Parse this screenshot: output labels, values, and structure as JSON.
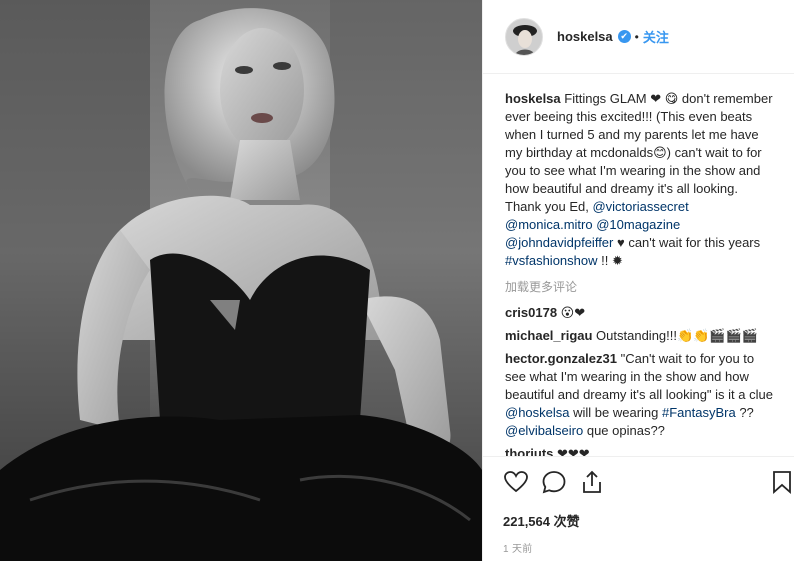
{
  "post": {
    "username": "hoskelsa",
    "verified_glyph": "✔",
    "separator": "•",
    "follow_label": "关注",
    "caption": {
      "user": "hoskelsa",
      "text": " Fittings GLAM ❤ 😋 don't remember ever beeing this excited!!! (This even beats when I turned 5 and my parents let me have my birthday at mcdonalds😊) can't wait to for you to see what I'm wearing in the show and how beautiful and dreamy it's all looking. Thank you Ed, ",
      "mention1": "@victoriassecret",
      "mention2": "@monica.mitro",
      "mention3": "@10magazine",
      "mention4": "@johndavidpfeiffer",
      "text2": " ♥ can't wait for this years ",
      "hashtag": "#vsfashionshow",
      "text3": " !! ✹"
    },
    "load_more": "加载更多评论",
    "comments": [
      {
        "user": "cris0178",
        "text": " 😮❤"
      },
      {
        "user": "michael_rigau",
        "text": " Outstanding!!!👏👏🎬🎬🎬"
      },
      {
        "user": "hector.gonzalez31",
        "text_a": " \"Can't wait to for you to see what I'm wearing in the show and how beautiful and dreamy it's all looking\" is it a clue ",
        "mention": "@hoskelsa",
        "text_b": " will be wearing ",
        "hashtag": "#FantasyBra",
        "text_c": " ?? ",
        "mention2": "@elvibalseiro",
        "text_d": " que opinas??"
      },
      {
        "user": "thoriuts",
        "text": " ❤❤❤"
      }
    ],
    "likes": "221,564 次赞",
    "time": "1 天前"
  },
  "icons": {
    "like": "heart-icon",
    "comment": "comment-icon",
    "share": "share-icon",
    "save": "bookmark-icon",
    "avatar": "avatar"
  },
  "colors": {
    "link": "#003569",
    "accent": "#3897f0",
    "muted": "#999999"
  }
}
